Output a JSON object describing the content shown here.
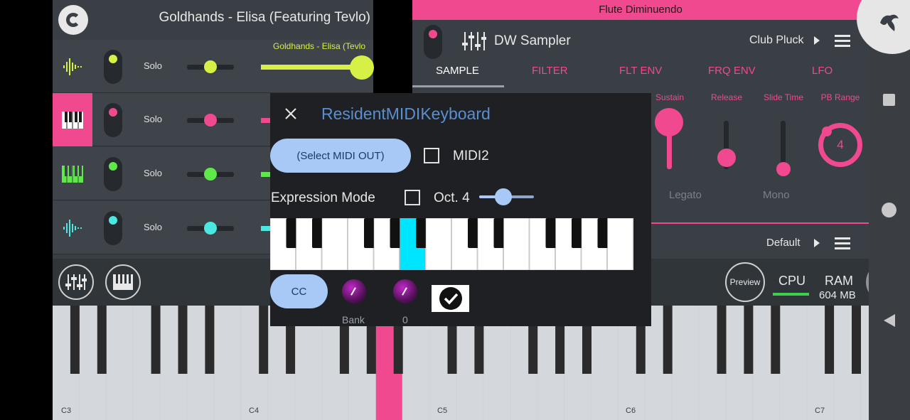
{
  "mixer": {
    "song_title": "Goldhands - Elisa (Featuring Tevlo)",
    "clip_label": "Goldhands - Elisa (Tevlo",
    "tracks": [
      {
        "solo": "Solo",
        "color": "#d6f046",
        "icon": "waveform-icon"
      },
      {
        "solo": "Solo",
        "color": "#f0498f",
        "icon": "piano-icon"
      },
      {
        "solo": "Solo",
        "color": "#5ee84a",
        "icon": "piano-icon"
      },
      {
        "solo": "Solo",
        "color": "#4ae8e0",
        "icon": "waveform-icon"
      }
    ]
  },
  "sampler": {
    "header_title": "Flute Diminuendo",
    "name": "DW Sampler",
    "preset": "Club Pluck",
    "tabs": [
      "SAMPLE",
      "FILTER",
      "FLT ENV",
      "FRQ ENV",
      "LFO"
    ],
    "active_tab": "SAMPLE",
    "params": {
      "sustain": "Sustain",
      "release": "Release",
      "slide_time": "Slide Time",
      "pb_range": "PB Range",
      "pb_range_value": "4",
      "legato": "Legato",
      "mono": "Mono"
    },
    "default_preset": "Default"
  },
  "toolbar": {
    "preview": "Preview",
    "cpu_label": "CPU",
    "ram_label": "RAM",
    "ram_value": "604 MB"
  },
  "dialog": {
    "title": "ResidentMIDIKeyboard",
    "select_midi_out": "(Select MIDI OUT)",
    "midi2_label": "MIDI2",
    "midi2_checked": false,
    "expression_mode_label": "Expression Mode",
    "expression_mode_checked": false,
    "octave_label": "Oct. 4",
    "octave_level": 0.45,
    "cc_button": "CC",
    "knobs": [
      {
        "label": "Bank"
      },
      {
        "label": "0"
      }
    ],
    "checkbox_checked": true
  },
  "keyboard": {
    "octave_labels": [
      "C3",
      "C4",
      "C5",
      "C6",
      "C7"
    ]
  },
  "colors": {
    "accent_pink": "#f0498f",
    "dialog_blue": "#a8c9f5",
    "title_blue": "#5a8fcf",
    "active_key_cyan": "#00e5ff"
  }
}
